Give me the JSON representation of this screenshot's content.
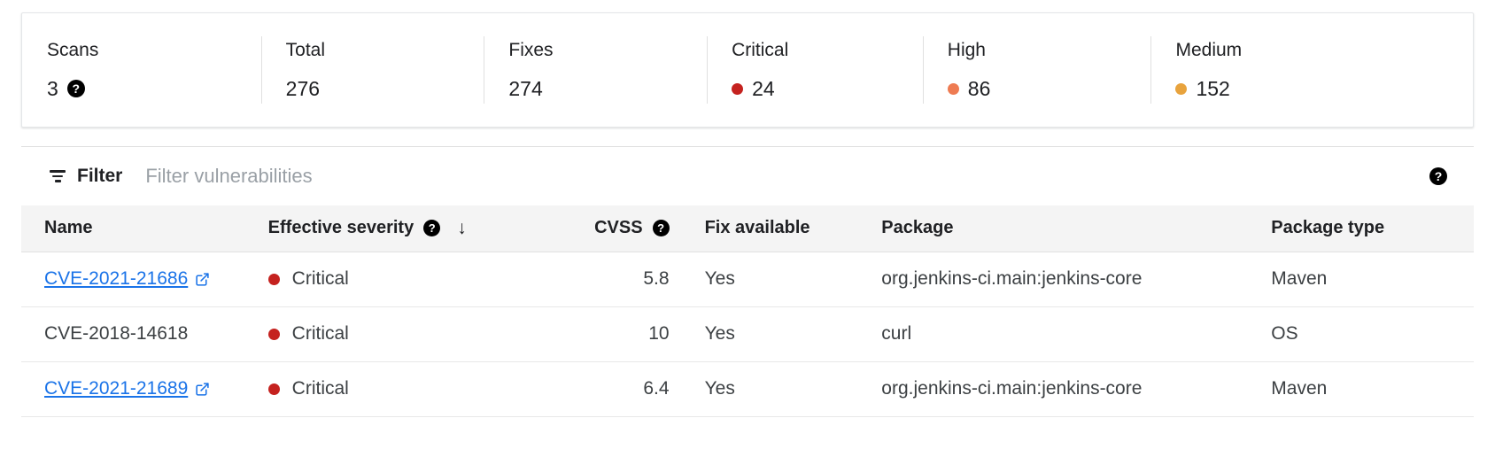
{
  "summary": {
    "stats": [
      {
        "label": "Scans",
        "value": "3",
        "dot_color": null,
        "help_icon": "help-icon"
      },
      {
        "label": "Total",
        "value": "276",
        "dot_color": null,
        "help_icon": null
      },
      {
        "label": "Fixes",
        "value": "274",
        "dot_color": null,
        "help_icon": null
      },
      {
        "label": "Critical",
        "value": "24",
        "dot_color": "#c5221f",
        "help_icon": null
      },
      {
        "label": "High",
        "value": "86",
        "dot_color": "#ee7b52",
        "help_icon": null
      },
      {
        "label": "Medium",
        "value": "152",
        "dot_color": "#e8a33d",
        "help_icon": null
      }
    ]
  },
  "filter_bar": {
    "icon": "filter-icon",
    "label": "Filter",
    "placeholder": "Filter vulnerabilities",
    "value": "",
    "help_icon": "help-icon"
  },
  "table": {
    "columns": [
      {
        "key": "name",
        "label": "Name",
        "help": false,
        "sort": null
      },
      {
        "key": "severity",
        "label": "Effective severity",
        "help": true,
        "sort": "desc"
      },
      {
        "key": "cvss",
        "label": "CVSS",
        "help": true,
        "sort": null
      },
      {
        "key": "fix",
        "label": "Fix available",
        "help": false,
        "sort": null
      },
      {
        "key": "package",
        "label": "Package",
        "help": false,
        "sort": null
      },
      {
        "key": "package_type",
        "label": "Package type",
        "help": false,
        "sort": null
      }
    ],
    "sort_arrow_glyph": "↓",
    "rows": [
      {
        "name": "CVE-2021-21686",
        "name_is_link": true,
        "severity": "Critical",
        "severity_color": "#c5221f",
        "cvss": "5.8",
        "fix": "Yes",
        "package": "org.jenkins-ci.main:jenkins-core",
        "package_type": "Maven"
      },
      {
        "name": "CVE-2018-14618",
        "name_is_link": false,
        "severity": "Critical",
        "severity_color": "#c5221f",
        "cvss": "10",
        "fix": "Yes",
        "package": "curl",
        "package_type": "OS"
      },
      {
        "name": "CVE-2021-21689",
        "name_is_link": true,
        "severity": "Critical",
        "severity_color": "#c5221f",
        "cvss": "6.4",
        "fix": "Yes",
        "package": "org.jenkins-ci.main:jenkins-core",
        "package_type": "Maven"
      }
    ]
  },
  "colors": {
    "link": "#1a73e8",
    "critical": "#c5221f",
    "high": "#ee7b52",
    "medium": "#e8a33d",
    "text": "#202124",
    "muted": "#3c4043",
    "placeholder": "#9aa0a6",
    "header_bg": "#f4f4f4",
    "border": "#e0e0e0"
  },
  "help_glyph": "?"
}
